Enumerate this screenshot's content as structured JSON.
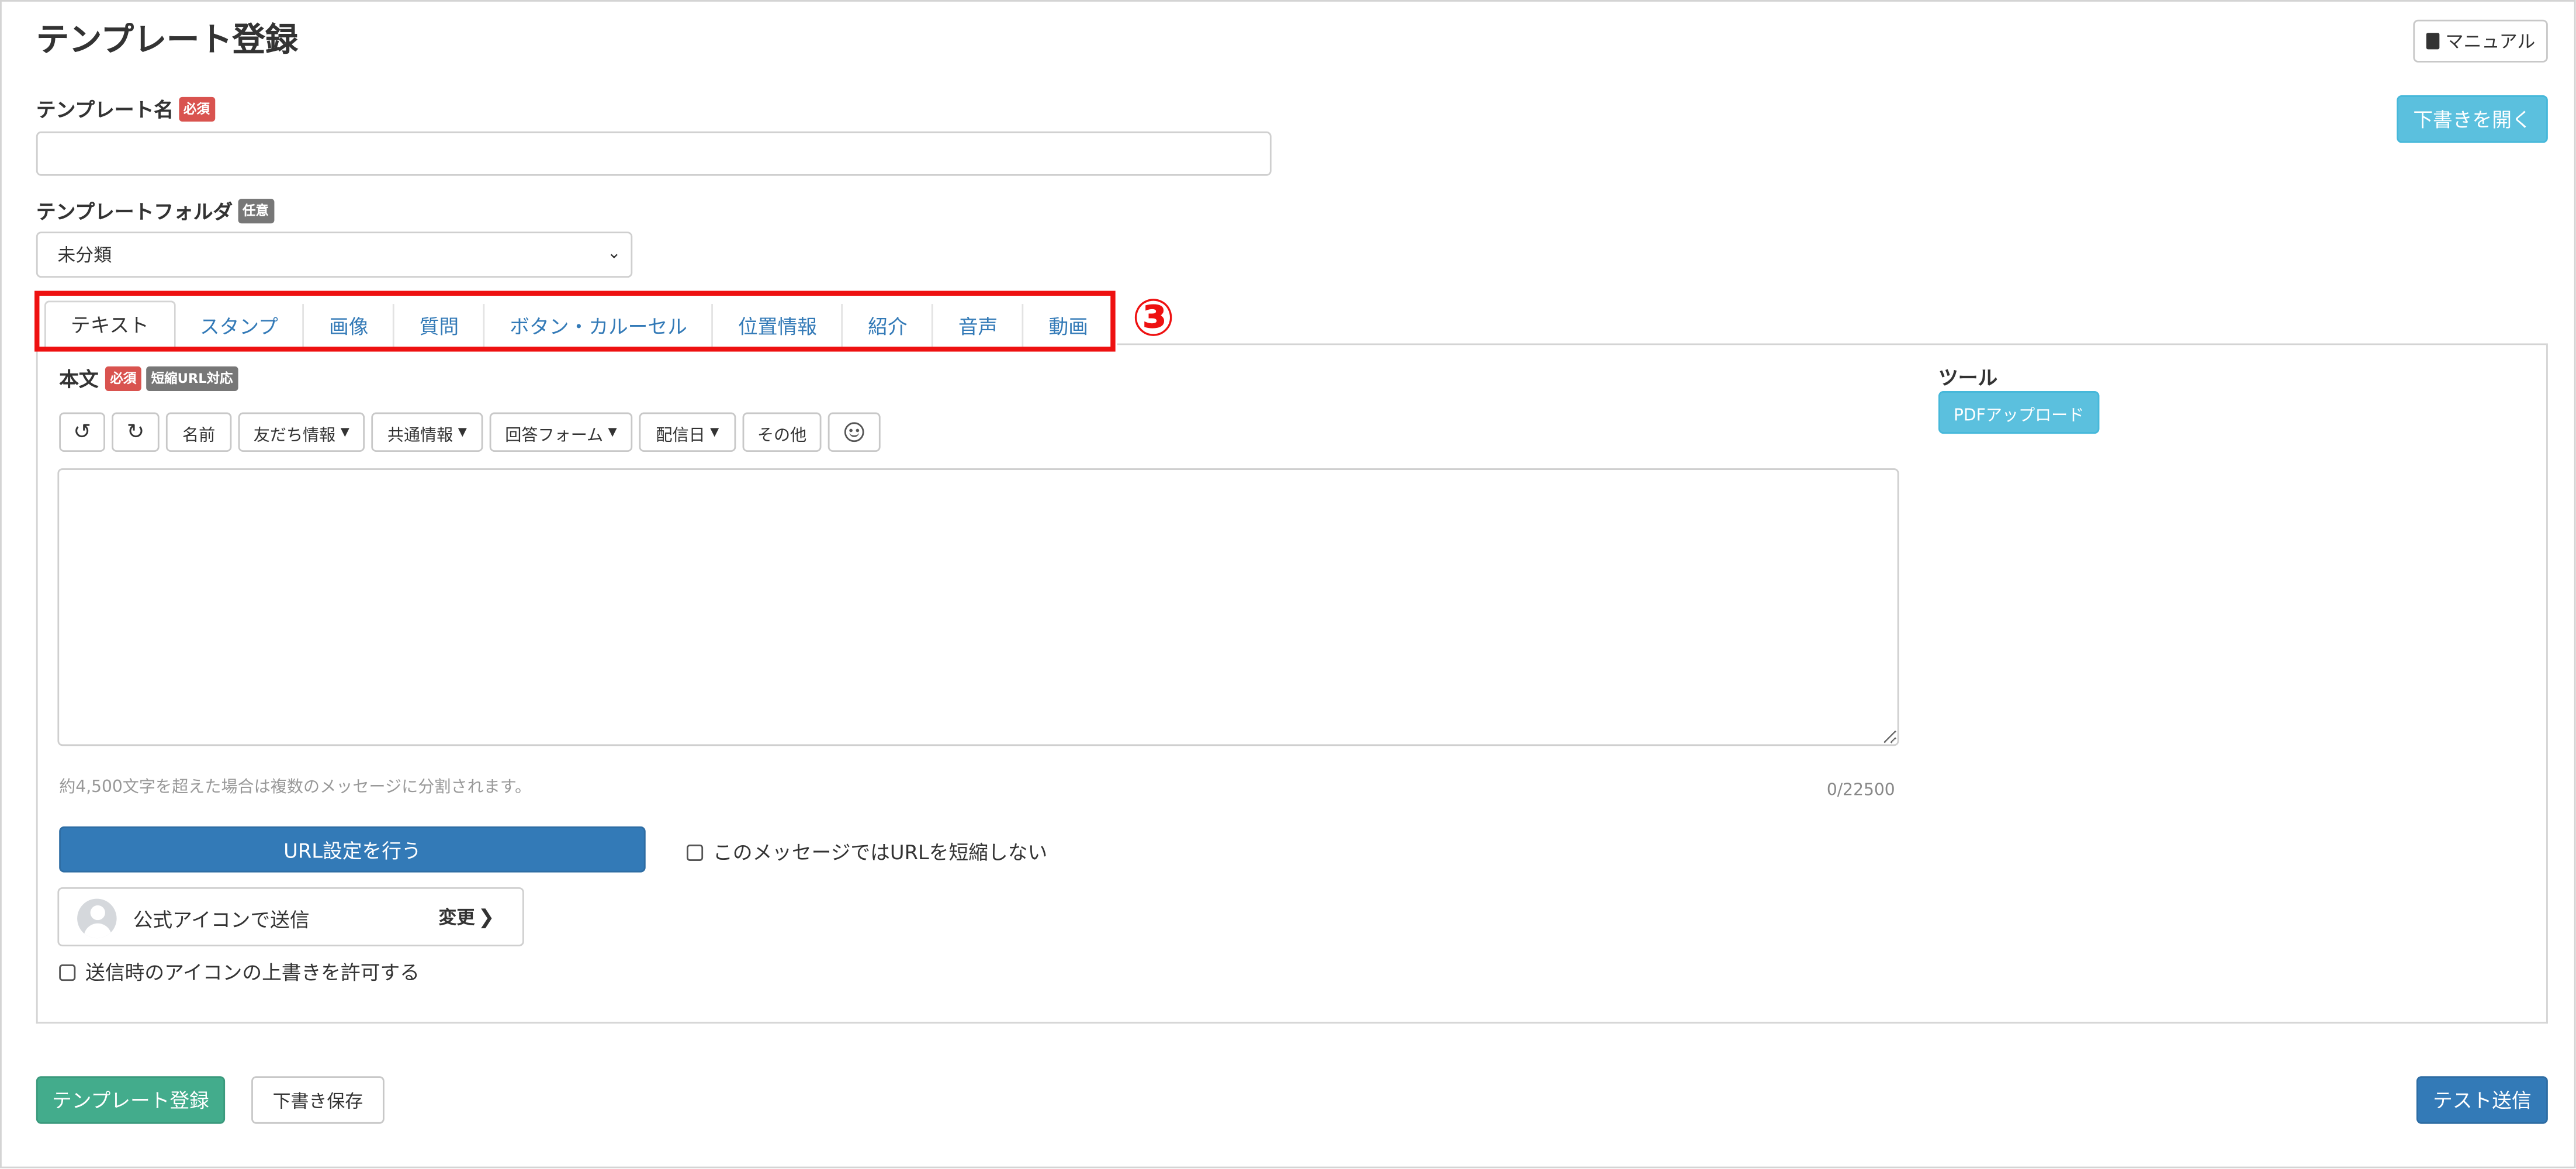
{
  "page": {
    "title": "テンプレート登録"
  },
  "header": {
    "manual_label": "マニュアル",
    "manual_icon": "book-icon",
    "open_draft_label": "下書きを開く"
  },
  "template_name": {
    "label": "テンプレート名",
    "badge": "必須",
    "value": "",
    "placeholder": ""
  },
  "template_folder": {
    "label": "テンプレートフォルダ",
    "badge": "任意",
    "selected": "未分類"
  },
  "tabs": [
    {
      "label": "テキスト",
      "active": true
    },
    {
      "label": "スタンプ"
    },
    {
      "label": "画像"
    },
    {
      "label": "質問"
    },
    {
      "label": "ボタン・カルーセル"
    },
    {
      "label": "位置情報"
    },
    {
      "label": "紹介"
    },
    {
      "label": "音声"
    },
    {
      "label": "動画"
    }
  ],
  "annotation": {
    "step": "③",
    "color": "#ee1111"
  },
  "body": {
    "label": "本文",
    "badge_required": "必須",
    "badge_short_url": "短縮URL対応",
    "toolbar": {
      "undo_icon": "undo-icon",
      "redo_icon": "redo-icon",
      "name": "名前",
      "friend_info": "友だち情報",
      "common_info": "共通情報",
      "answer_form": "回答フォーム",
      "delivery_date": "配信日",
      "other": "その他",
      "emoji_icon": "smiley-icon"
    },
    "message_value": "",
    "hint": "約4,500文字を超えた場合は複数のメッセージに分割されます。",
    "char_count": "0/22500",
    "url_button": "URL設定を行う",
    "no_shorten_label": "このメッセージではURLを短縮しない",
    "sender": {
      "label": "公式アイコンで送信",
      "change": "変更"
    },
    "allow_override_label": "送信時のアイコンの上書きを許可する"
  },
  "tools": {
    "label": "ツール",
    "pdf_upload": "PDFアップロード"
  },
  "footer": {
    "register": "テンプレート登録",
    "save_draft": "下書き保存",
    "test_send": "テスト送信"
  },
  "colors": {
    "primary": "#337ab7",
    "info": "#5bc0de",
    "success": "#43ac8c",
    "danger": "#d9534f",
    "tab_link": "#337ab7"
  }
}
